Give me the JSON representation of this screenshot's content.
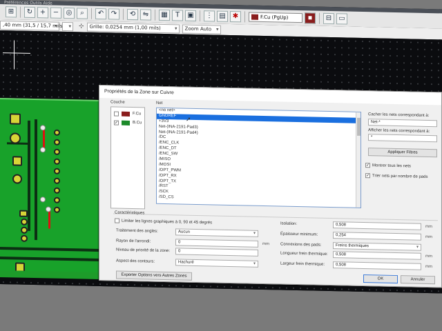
{
  "window": {
    "menu_text": "Préférences  Outils  Aide"
  },
  "toolbar": {
    "layer_select": "F.Cu (PgUp)",
    "track_width": ",40 mm (31,5 / 15,7 mils) *",
    "grid": "Grille: 0,0254 mm (1,00 mils)",
    "zoom": "Zoom Auto"
  },
  "dialog": {
    "title": "Propriétés de la Zone sur Cuivre",
    "layer_header": "Couche",
    "net_header": "Net",
    "layers": [
      {
        "name": "F.Cu",
        "checked": false,
        "color": "#8a1d1d"
      },
      {
        "name": "B.Cu",
        "checked": true,
        "color": "#1c8a2a"
      }
    ],
    "nets": [
      "<no net>",
      "GNDREF",
      "+3V3",
      "Net-(INA-2191-Pad3)",
      "Net-(INA-2191-Pad4)",
      "/DC",
      "/ENC_CLK",
      "/ENC_DT",
      "/ENC_SW",
      "/MISO",
      "/MOSI",
      "/OPT_PWM",
      "/OPT_RX",
      "/OPT_TX",
      "/RST",
      "/SCK",
      "/SD_CS"
    ],
    "selected_net": "GNDREF",
    "hide_nets_label": "Cacher les nets correspondant à:",
    "hide_nets_value": "Net-*",
    "show_nets_label": "Afficher les nets correspondant à:",
    "show_nets_value": "*",
    "apply_filters": "Appliquer Filtres",
    "show_all_nets": "Montrer tous les nets",
    "sort_by_pads": "Trier nets par nombre de pads",
    "characteristics": "Caractéristiques",
    "limit_lines": "Limiter les lignes graphiques à 0, 90 et 45 degrés",
    "corner_treatment_label": "Traitement des angles:",
    "corner_treatment_value": "Aucun",
    "fillet_radius_label": "Rayon de l'arrondi:",
    "fillet_radius_value": "0",
    "priority_label": "Niveau de priorité de la zone:",
    "priority_value": "0",
    "outline_label": "Aspect des contours:",
    "outline_value": "Hachuré",
    "clearance_label": "Isolation:",
    "clearance_value": "0,508",
    "min_width_label": "Épaisseur minimum:",
    "min_width_value": "0,254",
    "pad_conn_label": "Connexions des pads:",
    "pad_conn_value": "Freins thermiques",
    "thermal_gap_label": "Longueur frein thermique:",
    "thermal_gap_value": "0,508",
    "thermal_width_label": "Largeur frein thermique:",
    "thermal_width_value": "0,508",
    "unit": "mm",
    "export_button": "Exporter Options vers Autres Zones",
    "ok": "OK",
    "cancel": "Annuler"
  }
}
